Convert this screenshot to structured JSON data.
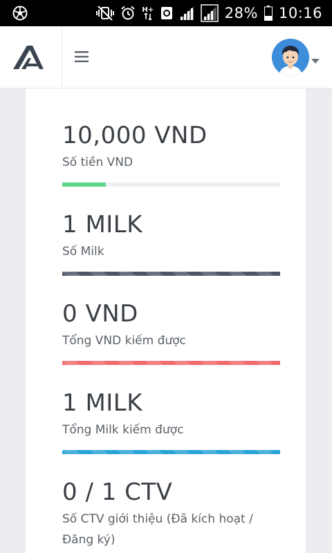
{
  "status_bar": {
    "battery": "28%",
    "time": "10:16",
    "network_type": "H+",
    "icons": [
      "app-notification-icon",
      "mute-vibrate-icon",
      "alarm-icon",
      "network-hplus-icon",
      "data-sync-icon",
      "signal-icon",
      "signal-icon",
      "battery-icon"
    ]
  },
  "header": {
    "logo": "brand-logo",
    "menu": "hamburger-menu-icon",
    "avatar": "user-avatar",
    "caret": "caret-down-icon"
  },
  "stats": [
    {
      "value": "10,000 VND",
      "label": "Số tiền VND",
      "progress": 0.2,
      "color": "#5cd68b"
    },
    {
      "value": "1 MILK",
      "label": "Số Milk",
      "progress": 1.0,
      "color": "#4e5566"
    },
    {
      "value": "0 VND",
      "label": "Tổng VND kiếm được",
      "progress": 1.0,
      "color": "#ee6b6e"
    },
    {
      "value": "1 MILK",
      "label": "Tổng Milk kiếm được",
      "progress": 1.0,
      "color": "#2aa3d6"
    },
    {
      "value": "0 / 1 CTV",
      "label": "Số CTV giới thiệu (Đã kích hoạt / Đăng ký)"
    }
  ]
}
